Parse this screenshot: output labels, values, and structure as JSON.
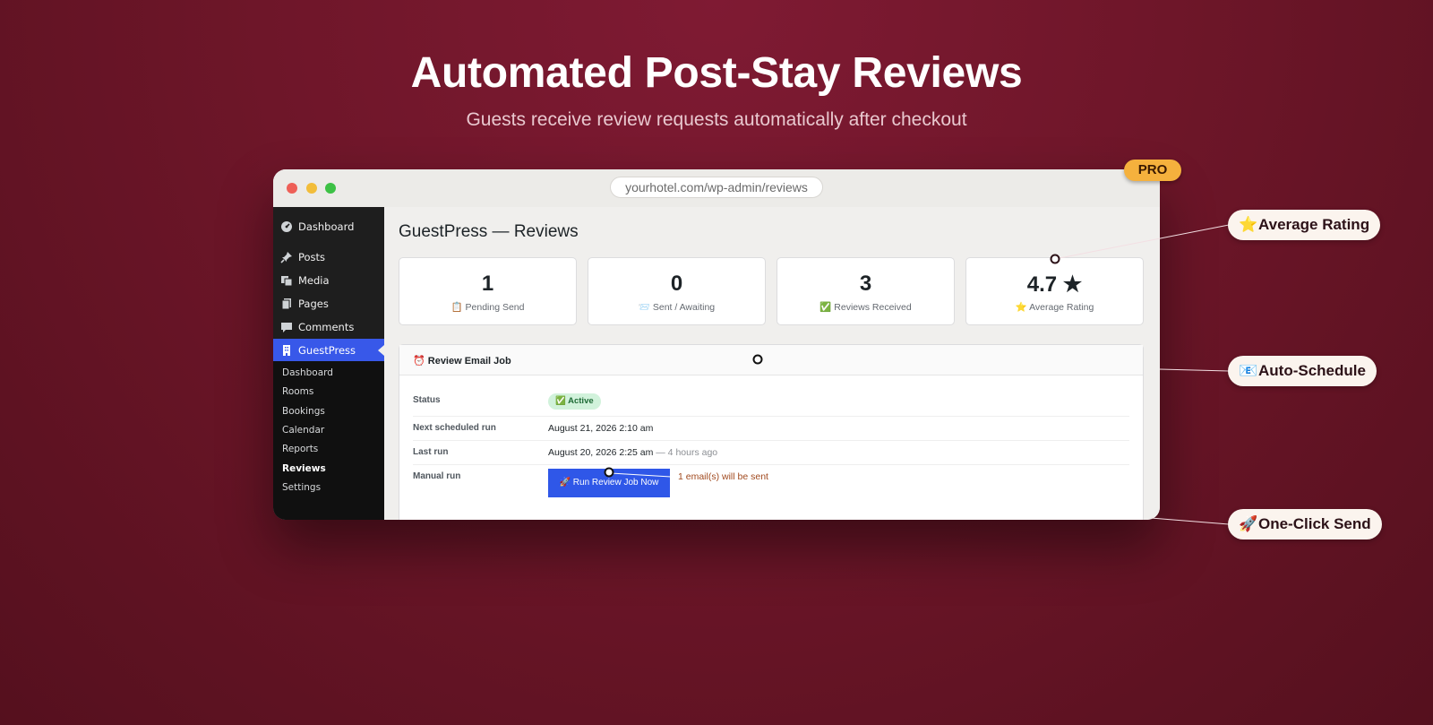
{
  "hero": {
    "title": "Automated Post-Stay Reviews",
    "subtitle": "Guests receive review requests automatically after checkout"
  },
  "browser": {
    "url": "yourhotel.com/wp-admin/reviews"
  },
  "pro_badge": "PRO",
  "sidebar": {
    "items": [
      {
        "label": "Dashboard",
        "icon": "dashboard-icon"
      },
      {
        "label": "Posts",
        "icon": "pin-icon"
      },
      {
        "label": "Media",
        "icon": "media-icon"
      },
      {
        "label": "Pages",
        "icon": "pages-icon"
      },
      {
        "label": "Comments",
        "icon": "comment-icon"
      },
      {
        "label": "GuestPress",
        "icon": "building-icon"
      }
    ],
    "submenu": [
      "Dashboard",
      "Rooms",
      "Bookings",
      "Calendar",
      "Reports",
      "Reviews",
      "Settings"
    ]
  },
  "main": {
    "page_title": "GuestPress — Reviews",
    "stats": [
      {
        "value": "1",
        "label": "📋 Pending Send"
      },
      {
        "value": "0",
        "label": "📨 Sent / Awaiting"
      },
      {
        "value": "3",
        "label": "✅ Reviews Received"
      },
      {
        "value": "4.7 ★",
        "label": "⭐ Average Rating"
      }
    ],
    "job": {
      "title": "⏰ Review Email Job",
      "status_label": "Status",
      "status_value": "✅ Active",
      "next_label": "Next scheduled run",
      "next_value": "August 21, 2026 2:10 am",
      "last_label": "Last run",
      "last_value": "August 20, 2026 2:25 am",
      "last_ago": "— 4 hours ago",
      "manual_label": "Manual run",
      "button_label": "🚀 Run Review Job Now",
      "email_note": "1 email(s) will be sent"
    }
  },
  "callouts": [
    {
      "icon": "⭐",
      "label": "Average Rating"
    },
    {
      "icon": "📧",
      "label": "Auto-Schedule"
    },
    {
      "icon": "🚀",
      "label": "One-Click Send"
    }
  ],
  "colors": {
    "background": "#6e1629",
    "accent": "#3858e9",
    "button": "#2f57e8",
    "pro": "#f5b13d",
    "badge_bg": "#d1f2db"
  }
}
